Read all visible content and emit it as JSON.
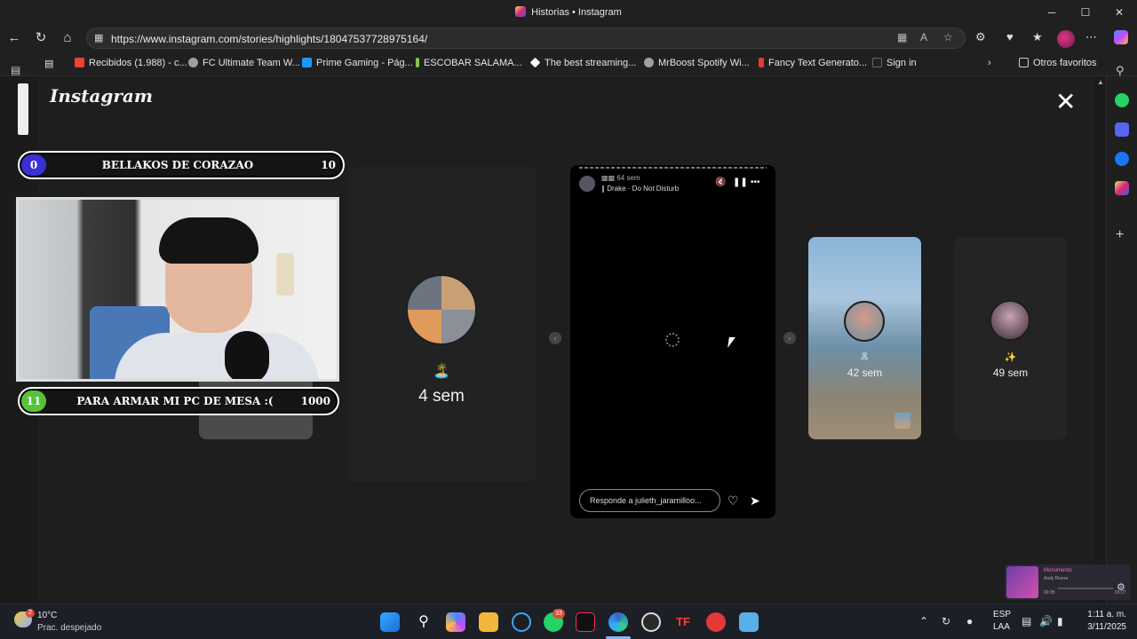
{
  "window": {
    "title": "Historias • Instagram",
    "minimize": "─",
    "maximize": "☐",
    "close": "✕"
  },
  "nav": {
    "url": "https://www.instagram.com/stories/highlights/18047537728975164/"
  },
  "favorites": [
    {
      "label": "Recibidos (1.988) - c...",
      "color": "#ea4335"
    },
    {
      "label": "FC Ultimate Team W...",
      "color": "#9aa0a6"
    },
    {
      "label": "Prime Gaming - Pág...",
      "color": "#1a98ff"
    },
    {
      "label": "ESCOBAR SALAMA...",
      "color": "#8bc34a"
    },
    {
      "label": "The best streaming...",
      "color": "#ffffff"
    },
    {
      "label": "MrBoost Spotify Wi...",
      "color": "#9aa0a6"
    },
    {
      "label": "Fancy Text Generato...",
      "color": "#e53935"
    },
    {
      "label": "Sign in",
      "color": "#222222"
    }
  ],
  "favorites_other": "Otros favoritos",
  "instagram": {
    "logo": "Instagram",
    "left_highlight": {
      "emoji": "🏝️",
      "label": "4 sem"
    },
    "right_highlight": {
      "label": "42 sem"
    },
    "far_right_highlight": {
      "emoji": "✨",
      "label": "49 sem"
    }
  },
  "story": {
    "time": "64 sem",
    "song": "Drake · Do Not Disturb",
    "reply_placeholder": "Responde a julieth_jaramilloo..."
  },
  "overlay": {
    "top_bar": {
      "count": "0",
      "text": "BELLAKOS DE CORAZAO",
      "goal": "10"
    },
    "bottom_bar": {
      "count": "11",
      "text": "PARA ARMAR MI PC DE MESA :(",
      "goal": "1000"
    }
  },
  "music_widget": {
    "title": "Monumento",
    "artist": "Andy Rivera",
    "elapsed": "00:05",
    "total": "03:27"
  },
  "taskbar": {
    "weather_temp": "10°C",
    "weather_desc": "Prac. despejado",
    "weather_badge": "2",
    "whatsapp_badge": "33",
    "lang_1": "ESP",
    "lang_2": "LAA",
    "time": "1:11 a. m.",
    "date": "3/11/2025"
  }
}
